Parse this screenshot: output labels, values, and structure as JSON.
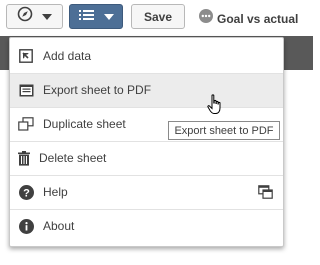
{
  "toolbar": {
    "navigate_icon": "compass-icon",
    "sheet_menu_icon": "list-icon",
    "save_label": "Save",
    "sheet_status_icon": "ellipsis-circle-icon",
    "sheet_title": "Goal vs actual"
  },
  "menu": {
    "items": [
      {
        "label": "Add data",
        "icon": "add-data-icon"
      },
      {
        "label": "Export sheet to PDF",
        "icon": "export-pdf-icon"
      },
      {
        "label": "Duplicate sheet",
        "icon": "duplicate-icon"
      },
      {
        "label": "Delete sheet",
        "icon": "trash-icon"
      },
      {
        "label": "Help",
        "icon": "help-icon",
        "secondary_icon": "external-window-icon"
      },
      {
        "label": "About",
        "icon": "info-icon"
      }
    ],
    "hovered_item": "Export sheet to PDF"
  },
  "tooltip": {
    "text": "Export sheet to PDF"
  },
  "colors": {
    "sheet_button": "#4d6f96",
    "strip": "#595959",
    "hover": "#ececec"
  }
}
